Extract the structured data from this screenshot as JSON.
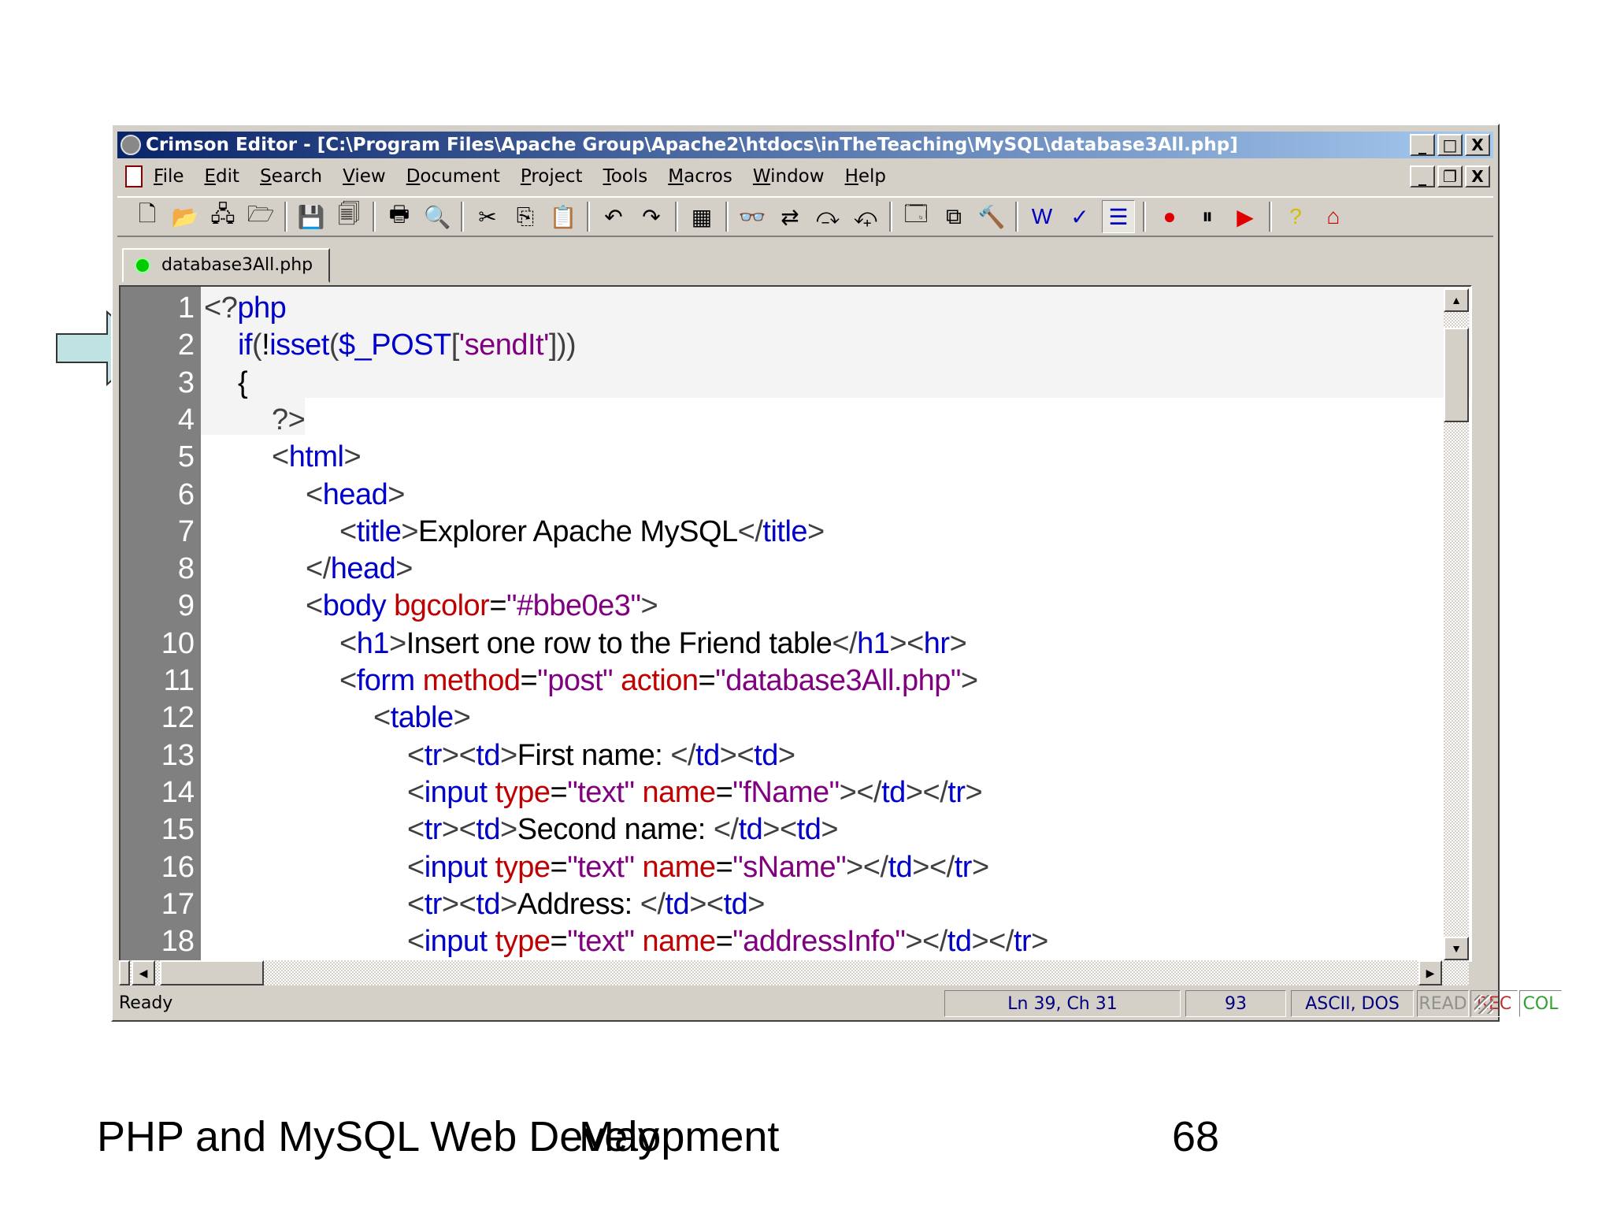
{
  "window": {
    "title": "Crimson Editor - [C:\\Program Files\\Apache Group\\Apache2\\htdocs\\inTheTeaching\\MySQL\\database3All.php]",
    "controls": {
      "minimize": "_",
      "maximize": "□",
      "close": "X",
      "restore": "❐"
    }
  },
  "menu": [
    "File",
    "Edit",
    "Search",
    "View",
    "Document",
    "Project",
    "Tools",
    "Macros",
    "Window",
    "Help"
  ],
  "toolbar": [
    {
      "name": "new-file",
      "glyph": "🗋"
    },
    {
      "name": "open-file",
      "glyph": "📂"
    },
    {
      "name": "open-remote",
      "glyph": "🖧"
    },
    {
      "name": "reopen",
      "glyph": "🗁"
    },
    {
      "sep": true
    },
    {
      "name": "save",
      "glyph": "💾"
    },
    {
      "name": "save-all",
      "glyph": "🗐"
    },
    {
      "sep": true
    },
    {
      "name": "print",
      "glyph": "🖶"
    },
    {
      "name": "print-preview",
      "glyph": "🔍"
    },
    {
      "sep": true
    },
    {
      "name": "cut",
      "glyph": "✂"
    },
    {
      "name": "copy",
      "glyph": "⎘"
    },
    {
      "name": "paste",
      "glyph": "📋"
    },
    {
      "sep": true
    },
    {
      "name": "undo",
      "glyph": "↶"
    },
    {
      "name": "redo",
      "glyph": "↷"
    },
    {
      "sep": true
    },
    {
      "name": "column-mode",
      "glyph": "▦"
    },
    {
      "sep": true
    },
    {
      "name": "find",
      "glyph": "👓"
    },
    {
      "name": "replace",
      "glyph": "⇄"
    },
    {
      "name": "find-next",
      "glyph": "⤼"
    },
    {
      "name": "find-prev",
      "glyph": "⤽"
    },
    {
      "sep": true
    },
    {
      "name": "open-project",
      "glyph": "🗔"
    },
    {
      "name": "windows",
      "glyph": "⧉"
    },
    {
      "name": "tools",
      "glyph": "🔨"
    },
    {
      "sep": true
    },
    {
      "name": "word-wrap",
      "glyph": "W"
    },
    {
      "name": "spell-check",
      "glyph": "✓"
    },
    {
      "name": "line-numbers",
      "glyph": "☰",
      "pressed": true
    },
    {
      "sep": true
    },
    {
      "name": "record-macro",
      "glyph": "●"
    },
    {
      "name": "pause-macro",
      "glyph": "⏸"
    },
    {
      "name": "play-macro",
      "glyph": "▶"
    },
    {
      "sep": true
    },
    {
      "name": "help",
      "glyph": "?"
    },
    {
      "name": "home",
      "glyph": "⌂"
    }
  ],
  "tab": {
    "label": "database3All.php"
  },
  "code": {
    "line_numbers": [
      "1",
      "2",
      "3",
      "4",
      "5",
      "6",
      "7",
      "8",
      "9",
      "10",
      "11",
      "12",
      "13",
      "14",
      "15",
      "16",
      "17",
      "18"
    ],
    "lines": [
      {
        "indent": 0,
        "tokens": [
          [
            "<?",
            "br"
          ],
          [
            "php",
            "kw"
          ]
        ]
      },
      {
        "indent": 1,
        "tokens": [
          [
            "if",
            "kw"
          ],
          [
            "(",
            "br"
          ],
          [
            "!",
            "plain"
          ],
          [
            "isset",
            "kw"
          ],
          [
            "(",
            "br"
          ],
          [
            "$_POST",
            "kw"
          ],
          [
            "[",
            "br"
          ],
          [
            "'sendIt'",
            "str"
          ],
          [
            "]))",
            "br"
          ]
        ]
      },
      {
        "indent": 1,
        "tokens": [
          [
            "{",
            "plain"
          ]
        ]
      },
      {
        "indent": 2,
        "tokens": [
          [
            "?>",
            "br"
          ]
        ]
      },
      {
        "indent": 2,
        "tokens": [
          [
            "<",
            "br"
          ],
          [
            "html",
            "tag"
          ],
          [
            ">",
            "br"
          ]
        ]
      },
      {
        "indent": 3,
        "tokens": [
          [
            "<",
            "br"
          ],
          [
            "head",
            "tag"
          ],
          [
            ">",
            "br"
          ]
        ]
      },
      {
        "indent": 4,
        "tokens": [
          [
            "<",
            "br"
          ],
          [
            "title",
            "tag"
          ],
          [
            ">",
            "br"
          ],
          [
            "Explorer Apache MySQL",
            "plain"
          ],
          [
            "</",
            "br"
          ],
          [
            "title",
            "tag"
          ],
          [
            ">",
            "br"
          ]
        ]
      },
      {
        "indent": 3,
        "tokens": [
          [
            "</",
            "br"
          ],
          [
            "head",
            "tag"
          ],
          [
            ">",
            "br"
          ]
        ]
      },
      {
        "indent": 3,
        "tokens": [
          [
            "<",
            "br"
          ],
          [
            "body ",
            "tag"
          ],
          [
            "bgcolor",
            "attr"
          ],
          [
            "=",
            "plain"
          ],
          [
            "\"#bbe0e3\"",
            "str"
          ],
          [
            ">",
            "br"
          ]
        ]
      },
      {
        "indent": 4,
        "tokens": [
          [
            "<",
            "br"
          ],
          [
            "h1",
            "tag"
          ],
          [
            ">",
            "br"
          ],
          [
            "Insert one row to the Friend table",
            "plain"
          ],
          [
            "</",
            "br"
          ],
          [
            "h1",
            "tag"
          ],
          [
            "><",
            "br"
          ],
          [
            "hr",
            "tag"
          ],
          [
            ">",
            "br"
          ]
        ]
      },
      {
        "indent": 4,
        "tokens": [
          [
            "<",
            "br"
          ],
          [
            "form ",
            "tag"
          ],
          [
            "method",
            "attr"
          ],
          [
            "=",
            "plain"
          ],
          [
            "\"post\" ",
            "str"
          ],
          [
            "action",
            "attr"
          ],
          [
            "=",
            "plain"
          ],
          [
            "\"database3All.php\"",
            "str"
          ],
          [
            ">",
            "br"
          ]
        ]
      },
      {
        "indent": 5,
        "tokens": [
          [
            "<",
            "br"
          ],
          [
            "table",
            "tag"
          ],
          [
            ">",
            "br"
          ]
        ]
      },
      {
        "indent": 6,
        "tokens": [
          [
            "<",
            "br"
          ],
          [
            "tr",
            "tag"
          ],
          [
            "><",
            "br"
          ],
          [
            "td",
            "tag"
          ],
          [
            ">",
            "br"
          ],
          [
            "First name: ",
            "plain"
          ],
          [
            "</",
            "br"
          ],
          [
            "td",
            "tag"
          ],
          [
            "><",
            "br"
          ],
          [
            "td",
            "tag"
          ],
          [
            ">",
            "br"
          ]
        ]
      },
      {
        "indent": 6,
        "tokens": [
          [
            "<",
            "br"
          ],
          [
            "input ",
            "tag"
          ],
          [
            "type",
            "attr"
          ],
          [
            "=",
            "plain"
          ],
          [
            "\"text\" ",
            "str"
          ],
          [
            "name",
            "attr"
          ],
          [
            "=",
            "plain"
          ],
          [
            "\"fName\"",
            "str"
          ],
          [
            "></",
            "br"
          ],
          [
            "td",
            "tag"
          ],
          [
            "></",
            "br"
          ],
          [
            "tr",
            "tag"
          ],
          [
            ">",
            "br"
          ]
        ]
      },
      {
        "indent": 6,
        "tokens": [
          [
            "<",
            "br"
          ],
          [
            "tr",
            "tag"
          ],
          [
            "><",
            "br"
          ],
          [
            "td",
            "tag"
          ],
          [
            ">",
            "br"
          ],
          [
            "Second name: ",
            "plain"
          ],
          [
            "</",
            "br"
          ],
          [
            "td",
            "tag"
          ],
          [
            "><",
            "br"
          ],
          [
            "td",
            "tag"
          ],
          [
            ">",
            "br"
          ]
        ]
      },
      {
        "indent": 6,
        "tokens": [
          [
            "<",
            "br"
          ],
          [
            "input ",
            "tag"
          ],
          [
            "type",
            "attr"
          ],
          [
            "=",
            "plain"
          ],
          [
            "\"text\" ",
            "str"
          ],
          [
            "name",
            "attr"
          ],
          [
            "=",
            "plain"
          ],
          [
            "\"sName\"",
            "str"
          ],
          [
            "></",
            "br"
          ],
          [
            "td",
            "tag"
          ],
          [
            "></",
            "br"
          ],
          [
            "tr",
            "tag"
          ],
          [
            ">",
            "br"
          ]
        ]
      },
      {
        "indent": 6,
        "tokens": [
          [
            "<",
            "br"
          ],
          [
            "tr",
            "tag"
          ],
          [
            "><",
            "br"
          ],
          [
            "td",
            "tag"
          ],
          [
            ">",
            "br"
          ],
          [
            "Address: ",
            "plain"
          ],
          [
            "</",
            "br"
          ],
          [
            "td",
            "tag"
          ],
          [
            "><",
            "br"
          ],
          [
            "td",
            "tag"
          ],
          [
            ">",
            "br"
          ]
        ]
      },
      {
        "indent": 6,
        "tokens": [
          [
            "<",
            "br"
          ],
          [
            "input ",
            "tag"
          ],
          [
            "type",
            "attr"
          ],
          [
            "=",
            "plain"
          ],
          [
            "\"text\" ",
            "str"
          ],
          [
            "name",
            "attr"
          ],
          [
            "=",
            "plain"
          ],
          [
            "\"addressInfo\"",
            "str"
          ],
          [
            "></",
            "br"
          ],
          [
            "td",
            "tag"
          ],
          [
            "></",
            "br"
          ],
          [
            "tr",
            "tag"
          ],
          [
            ">",
            "br"
          ]
        ]
      }
    ]
  },
  "status": {
    "message": "Ready",
    "position": "Ln 39, Ch 31",
    "column": "93",
    "encoding": "ASCII, DOS",
    "read": "READ",
    "rec": "REC",
    "col": "COL"
  },
  "footer": {
    "title": "PHP and MySQL Web Development",
    "overlay": "May",
    "page": "68"
  },
  "colors": {
    "arrow_fill": "#bfe3e3",
    "gutter": "#808080",
    "tag": "#0000c8",
    "attr": "#c00000",
    "string": "#800080"
  }
}
